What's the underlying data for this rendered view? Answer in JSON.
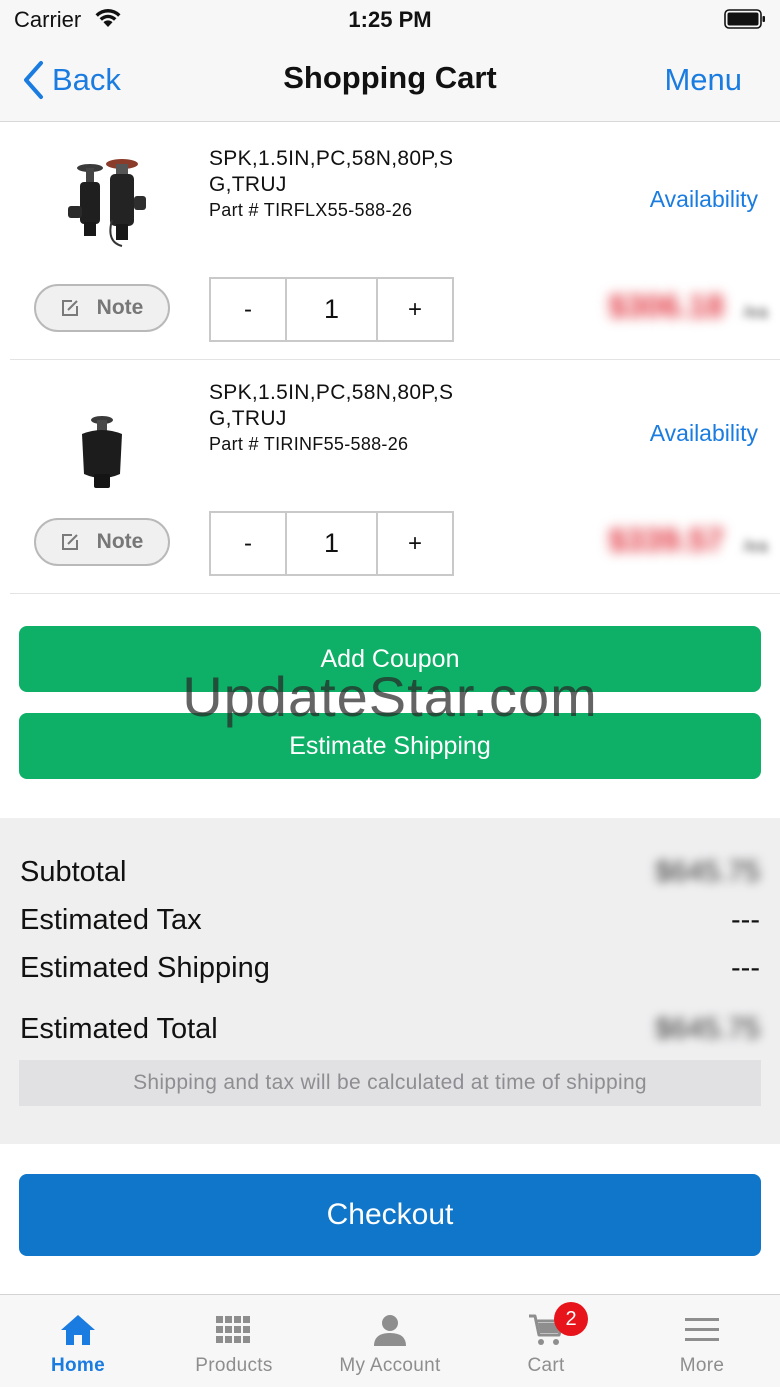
{
  "status_bar": {
    "carrier": "Carrier",
    "time": "1:25 PM"
  },
  "nav": {
    "back_label": "Back",
    "title": "Shopping Cart",
    "menu_label": "Menu"
  },
  "cart_items": [
    {
      "name": "SPK,1.5IN,PC,58N,80P,S G,TRUJ",
      "part_number": "Part # TIRFLX55-588-26",
      "availability_label": "Availability",
      "note_label": "Note",
      "qty_minus": "-",
      "quantity": "1",
      "qty_plus": "+",
      "price": "$306.18",
      "price_unit": "/ea"
    },
    {
      "name": "SPK,1.5IN,PC,58N,80P,S G,TRUJ",
      "part_number": "Part # TIRINF55-588-26",
      "availability_label": "Availability",
      "note_label": "Note",
      "qty_minus": "-",
      "quantity": "1",
      "qty_plus": "+",
      "price": "$339.57",
      "price_unit": "/ea"
    }
  ],
  "buttons": {
    "add_coupon": "Add Coupon",
    "estimate_shipping": "Estimate Shipping",
    "checkout": "Checkout"
  },
  "watermark": "UpdateStar.com",
  "summary": {
    "subtotal_label": "Subtotal",
    "subtotal_value": "$645.75",
    "tax_label": "Estimated Tax",
    "tax_value": "---",
    "shipping_label": "Estimated Shipping",
    "shipping_value": "---",
    "total_label": "Estimated Total",
    "total_value": "$645.75",
    "note": "Shipping and tax will be calculated at time of shipping"
  },
  "tabs": [
    {
      "label": "Home",
      "icon": "home-icon",
      "active": true
    },
    {
      "label": "Products",
      "icon": "grid-icon"
    },
    {
      "label": "My Account",
      "icon": "person-icon"
    },
    {
      "label": "Cart",
      "icon": "cart-icon",
      "badge": "2"
    },
    {
      "label": "More",
      "icon": "menu-icon"
    }
  ],
  "colors": {
    "accent_blue": "#1a7ce0",
    "green": "#0eaf66",
    "checkout_blue": "#0f76c9",
    "price_red": "#e0303a",
    "badge_red": "#e8141c"
  }
}
